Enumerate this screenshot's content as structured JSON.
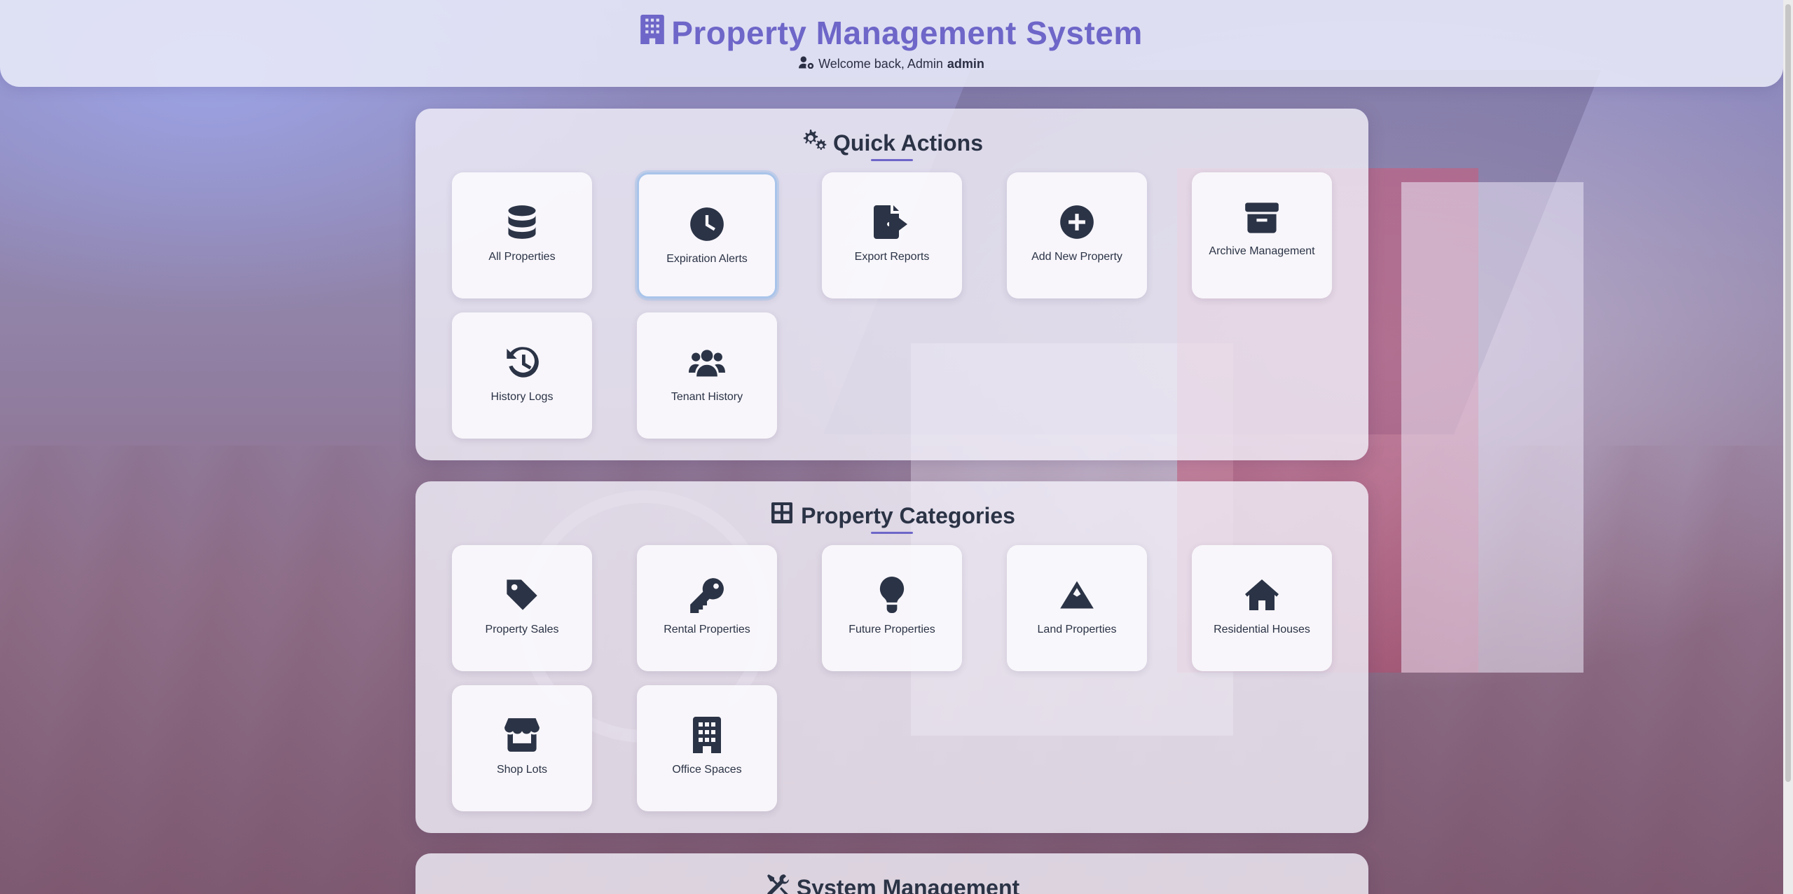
{
  "header": {
    "title": "Property Management System",
    "welcome_prefix": "Welcome back, Admin",
    "username": "admin"
  },
  "quick_actions": {
    "title": "Quick Actions",
    "items": [
      {
        "label": "All Properties",
        "icon": "database-icon"
      },
      {
        "label": "Expiration Alerts",
        "icon": "clock-icon"
      },
      {
        "label": "Export Reports",
        "icon": "file-export-icon"
      },
      {
        "label": "Add New Property",
        "icon": "plus-circle-icon"
      },
      {
        "label": "Archive Management",
        "icon": "archive-icon"
      },
      {
        "label": "History Logs",
        "icon": "history-icon"
      },
      {
        "label": "Tenant History",
        "icon": "users-icon"
      }
    ]
  },
  "property_categories": {
    "title": "Property Categories",
    "items": [
      {
        "label": "Property Sales",
        "icon": "tag-icon"
      },
      {
        "label": "Rental Properties",
        "icon": "key-icon"
      },
      {
        "label": "Future Properties",
        "icon": "lightbulb-icon"
      },
      {
        "label": "Land Properties",
        "icon": "mountain-icon"
      },
      {
        "label": "Residential Houses",
        "icon": "home-icon"
      },
      {
        "label": "Shop Lots",
        "icon": "store-icon"
      },
      {
        "label": "Office Spaces",
        "icon": "office-building-icon"
      }
    ]
  },
  "system_management": {
    "title": "System Management",
    "icon": "tools-icon"
  },
  "colors": {
    "brand": "#6e66c8",
    "text": "#2b3346",
    "focus_ring": "#a9c4ea"
  }
}
